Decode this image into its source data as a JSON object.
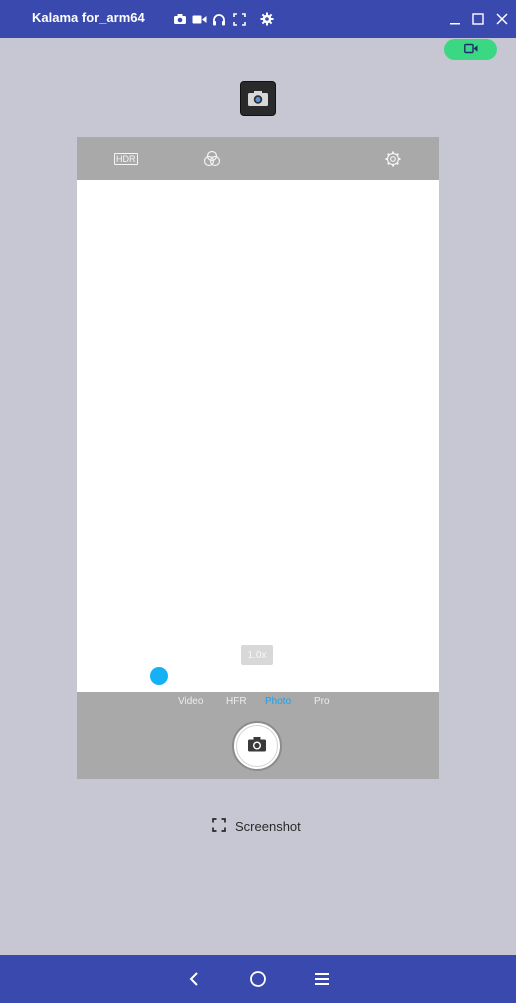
{
  "window": {
    "title": "Kalama for_arm64",
    "toolbar_icons": [
      "camera-icon",
      "video-icon",
      "headphones-icon",
      "fullscreen-icon",
      "gear-icon"
    ],
    "controls": [
      "minimize-icon",
      "maximize-icon",
      "close-icon"
    ]
  },
  "record": {
    "icon": "video-camera-icon",
    "accent": "#3bd884"
  },
  "camera": {
    "hdr_label": "HDR",
    "zoom_label": "1.0x",
    "modes": [
      {
        "label": "Video",
        "active": false
      },
      {
        "label": "HFR",
        "active": false
      },
      {
        "label": "Photo",
        "active": true
      },
      {
        "label": "Pro",
        "active": false
      }
    ],
    "active_color": "#1fa0e6",
    "focus_color": "#14b1f5"
  },
  "screenshot": {
    "label": "Screenshot",
    "icon": "screenshot-frame-icon"
  },
  "navbar": {
    "buttons": [
      "back-icon",
      "home-icon",
      "menu-icon"
    ]
  },
  "colors": {
    "titlebar": "#3a49ad",
    "background": "#c7c7d4"
  }
}
